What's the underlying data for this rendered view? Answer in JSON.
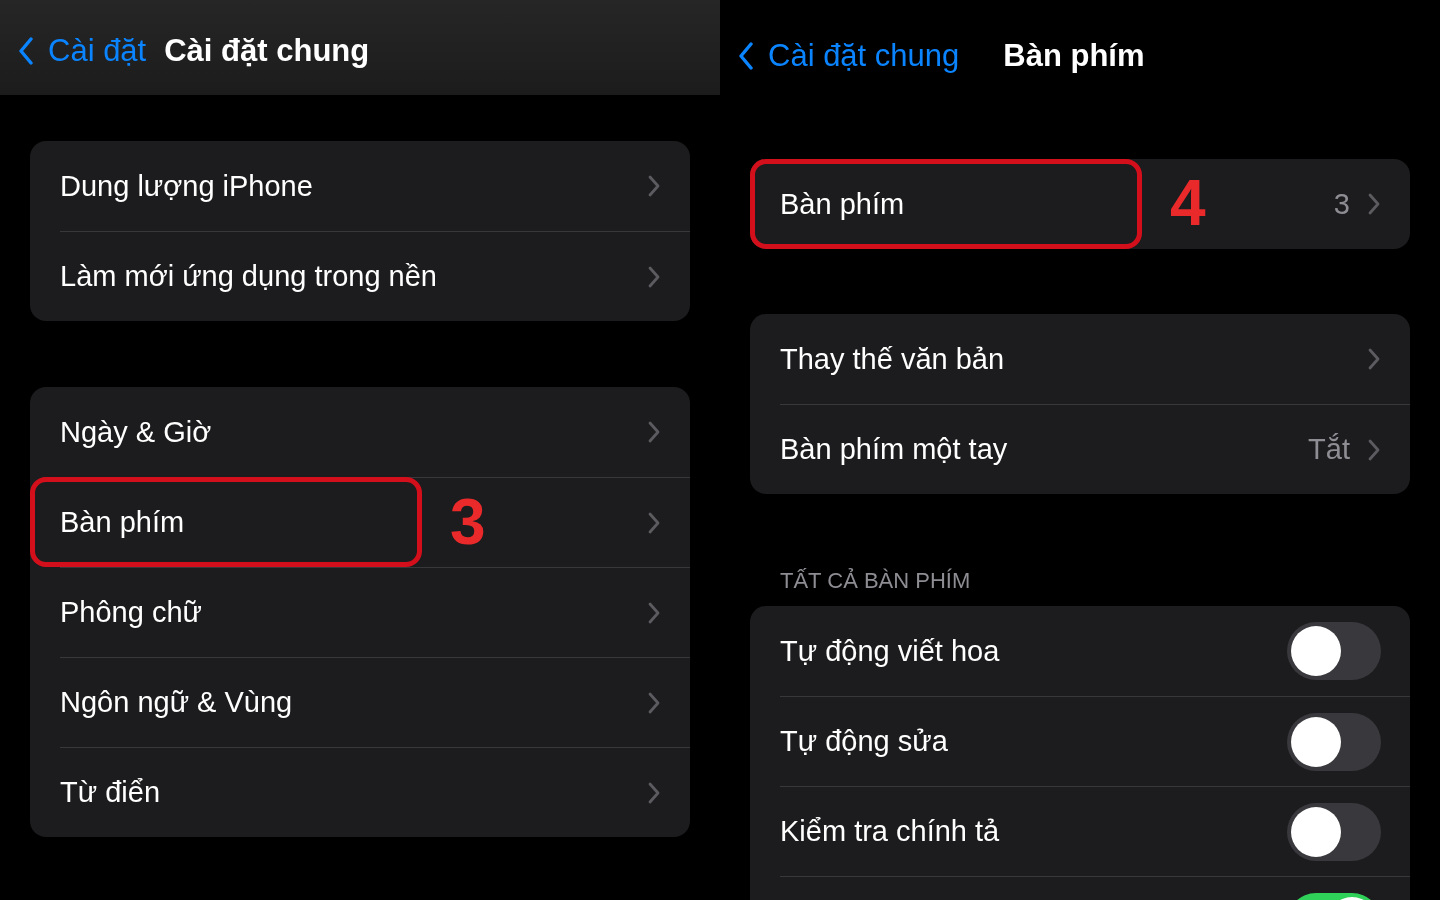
{
  "panels": [
    {
      "nav": {
        "back": "Cài đặt",
        "title": "Cài đặt chung",
        "bar": true
      },
      "groups": [
        {
          "rows": [
            {
              "kind": "link",
              "label": "Dung lượng iPhone"
            },
            {
              "kind": "link",
              "label": "Làm mới ứng dụng trong nền"
            }
          ]
        },
        {
          "rows": [
            {
              "kind": "link",
              "label": "Ngày & Giờ"
            },
            {
              "kind": "link",
              "label": "Bàn phím",
              "annotation": "3"
            },
            {
              "kind": "link",
              "label": "Phông chữ"
            },
            {
              "kind": "link",
              "label": "Ngôn ngữ & Vùng"
            },
            {
              "kind": "link",
              "label": "Từ điển"
            }
          ]
        }
      ]
    },
    {
      "nav": {
        "back": "Cài đặt chung",
        "title": "Bàn phím",
        "bar": false
      },
      "groups": [
        {
          "rows": [
            {
              "kind": "link",
              "label": "Bàn phím",
              "value": "3",
              "annotation": "4"
            }
          ]
        },
        {
          "rows": [
            {
              "kind": "link",
              "label": "Thay thế văn bản"
            },
            {
              "kind": "link",
              "label": "Bàn phím một tay",
              "value": "Tắt"
            }
          ]
        },
        {
          "header": "TẤT CẢ BÀN PHÍM",
          "rows": [
            {
              "kind": "toggle",
              "label": "Tự động viết hoa",
              "on": false
            },
            {
              "kind": "toggle",
              "label": "Tự động sửa",
              "on": false
            },
            {
              "kind": "toggle",
              "label": "Kiểm tra chính tả",
              "on": false
            },
            {
              "kind": "toggle",
              "on": true
            }
          ]
        }
      ]
    }
  ]
}
